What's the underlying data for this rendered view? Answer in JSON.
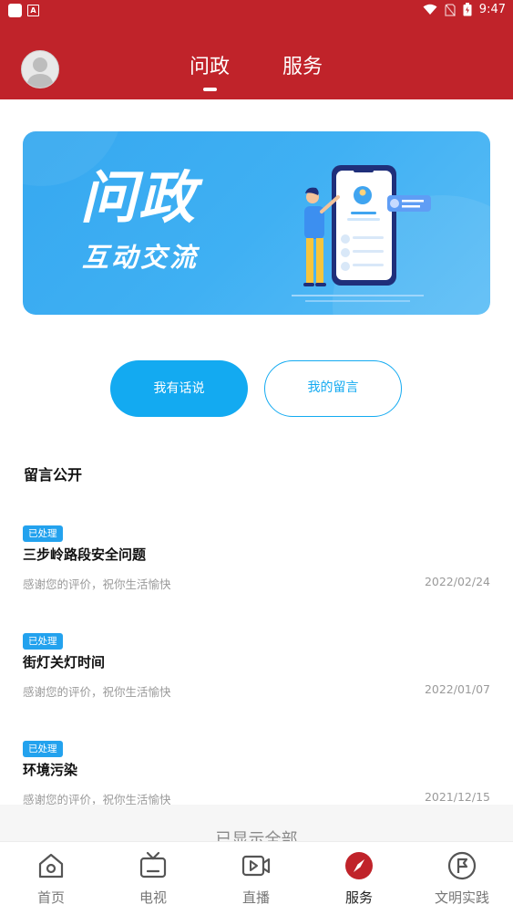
{
  "status_bar": {
    "time": "9:47",
    "badge_letter": "A"
  },
  "header": {
    "tabs": [
      {
        "label": "问政",
        "active": true
      },
      {
        "label": "服务",
        "active": false
      }
    ]
  },
  "banner": {
    "title": "问政",
    "subtitle": "互动交流"
  },
  "actions": {
    "speak_label": "我有话说",
    "my_messages_label": "我的留言"
  },
  "section": {
    "title": "留言公开"
  },
  "messages": [
    {
      "status": "已处理",
      "title": "三步岭路段安全问题",
      "reply": "感谢您的评价，祝你生活愉快",
      "date": "2022/02/24"
    },
    {
      "status": "已处理",
      "title": "街灯关灯时间",
      "reply": "感谢您的评价，祝你生活愉快",
      "date": "2022/01/07"
    },
    {
      "status": "已处理",
      "title": "环境污染",
      "reply": "感谢您的评价，祝你生活愉快",
      "date": "2021/12/15"
    }
  ],
  "all_shown_text": "已显示全部",
  "bottom_nav": [
    {
      "label": "首页",
      "icon": "home-icon",
      "active": false
    },
    {
      "label": "电视",
      "icon": "tv-icon",
      "active": false
    },
    {
      "label": "直播",
      "icon": "live-icon",
      "active": false
    },
    {
      "label": "服务",
      "icon": "compass-icon",
      "active": true
    },
    {
      "label": "文明实践",
      "icon": "flag-circle-icon",
      "active": false
    }
  ],
  "colors": {
    "brand_red": "#c0232a",
    "accent_blue": "#13aaf1",
    "badge_blue": "#23a2ee",
    "text_muted": "#9a9a9a"
  }
}
